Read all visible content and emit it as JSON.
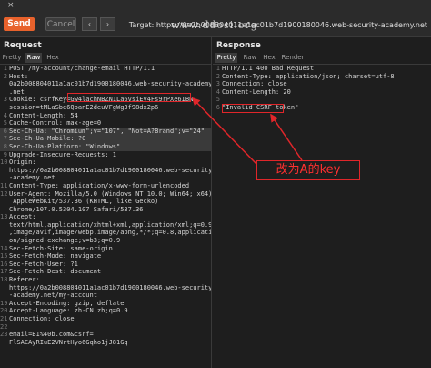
{
  "toolbar": {
    "close_label": "×",
    "send_label": "Send",
    "cancel_label": "Cancel",
    "watermark": "www.ddosi.org",
    "target_text": "Target: https://0a2b008804011a1ac01b7d1900180046.web-security-academy.net"
  },
  "request": {
    "title": "Request",
    "tabs": [
      "Pretty",
      "Raw",
      "Hex"
    ],
    "active_tab": "Raw",
    "lines": [
      {
        "n": "1",
        "text": "POST /my-account/change-email HTTP/1.1"
      },
      {
        "n": "2",
        "text": "Host:"
      },
      {
        "n": "",
        "text": "0a2b008804011a1ac01b7d1900180046.web-security-academy"
      },
      {
        "n": "",
        "text": ".net"
      },
      {
        "n": "3",
        "text": "Cookie: csrfKey=Gw4lachNBZN1La6vsiEv4Fs9rPXe6IBN;"
      },
      {
        "n": "",
        "text": "session=tMLaSbe6QpanE2deuVFgWg3f98dx2p6"
      },
      {
        "n": "4",
        "text": "Content-Length: 54"
      },
      {
        "n": "5",
        "text": "Cache-Control: max-age=0"
      },
      {
        "n": "6",
        "text": "Sec-Ch-Ua: \"Chromium\";v=\"107\", \"Not=A?Brand\";v=\"24\""
      },
      {
        "n": "7",
        "text": "Sec-Ch-Ua-Mobile: ?0"
      },
      {
        "n": "8",
        "text": "Sec-Ch-Ua-Platform: \"Windows\""
      },
      {
        "n": "9",
        "text": "Upgrade-Insecure-Requests: 1"
      },
      {
        "n": "10",
        "text": "Origin:"
      },
      {
        "n": "",
        "text": "https://0a2b008804011a1ac01b7d1900180046.web-security"
      },
      {
        "n": "",
        "text": "-academy.net"
      },
      {
        "n": "11",
        "text": "Content-Type: application/x-www-form-urlencoded"
      },
      {
        "n": "12",
        "text": "User-Agent: Mozilla/5.0 (Windows NT 10.0; Win64; x64)"
      },
      {
        "n": "",
        "text": " AppleWebKit/537.36 (KHTML, like Gecko)"
      },
      {
        "n": "",
        "text": "Chrome/107.0.5304.107 Safari/537.36"
      },
      {
        "n": "13",
        "text": "Accept:"
      },
      {
        "n": "",
        "text": "text/html,application/xhtml+xml,application/xml;q=0.9"
      },
      {
        "n": "",
        "text": ",image/avif,image/webp,image/apng,*/*;q=0.8,applicati"
      },
      {
        "n": "",
        "text": "on/signed-exchange;v=b3;q=0.9"
      },
      {
        "n": "14",
        "text": "Sec-Fetch-Site: same-origin"
      },
      {
        "n": "15",
        "text": "Sec-Fetch-Mode: navigate"
      },
      {
        "n": "16",
        "text": "Sec-Fetch-User: ?1"
      },
      {
        "n": "17",
        "text": "Sec-Fetch-Dest: document"
      },
      {
        "n": "18",
        "text": "Referer:"
      },
      {
        "n": "",
        "text": "https://0a2b008804011a1ac01b7d1900180046.web-security"
      },
      {
        "n": "",
        "text": "-academy.net/my-account"
      },
      {
        "n": "19",
        "text": "Accept-Encoding: gzip, deflate"
      },
      {
        "n": "20",
        "text": "Accept-Language: zh-CN,zh;q=0.9"
      },
      {
        "n": "21",
        "text": "Connection: close"
      },
      {
        "n": "22",
        "text": ""
      },
      {
        "n": "23",
        "text": "email=B1%40b.com&csrf="
      },
      {
        "n": "",
        "text": "FlSACAyRIuE2VNrtHyo6Gqho1jJ81Gq"
      }
    ]
  },
  "response": {
    "title": "Response",
    "tabs": [
      "Pretty",
      "Raw",
      "Hex",
      "Render"
    ],
    "active_tab": "Pretty",
    "lines": [
      {
        "n": "1",
        "text": "HTTP/1.1 400 Bad Request"
      },
      {
        "n": "2",
        "text": "Content-Type: application/json; charset=utf-8"
      },
      {
        "n": "3",
        "text": "Connection: close"
      },
      {
        "n": "4",
        "text": "Content-Length: 20"
      },
      {
        "n": "5",
        "text": ""
      },
      {
        "n": "6",
        "text": "\"Invalid CSRF token\""
      }
    ]
  },
  "annotation": {
    "text": "改为A的key"
  },
  "colors": {
    "accent": "#e8622c",
    "annotation": "#e0262a"
  }
}
